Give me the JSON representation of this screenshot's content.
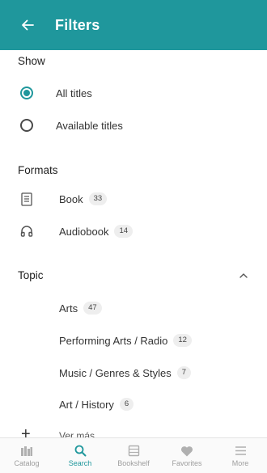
{
  "appbar": {
    "title": "Filters"
  },
  "show": {
    "label": "Show",
    "options": [
      {
        "label": "All titles",
        "selected": true
      },
      {
        "label": "Available titles",
        "selected": false
      }
    ]
  },
  "formats": {
    "label": "Formats",
    "items": [
      {
        "label": "Book",
        "count": "33",
        "icon": "book-icon"
      },
      {
        "label": "Audiobook",
        "count": "14",
        "icon": "headphones-icon"
      }
    ]
  },
  "topic": {
    "label": "Topic",
    "expanded": true,
    "items": [
      {
        "label": "Arts",
        "count": "47"
      },
      {
        "label": "Performing Arts / Radio",
        "count": "12"
      },
      {
        "label": "Music / Genres & Styles",
        "count": "7"
      },
      {
        "label": "Art / History",
        "count": "6"
      }
    ],
    "more_label": "Ver más"
  },
  "bottom_nav": {
    "items": [
      {
        "label": "Catalog",
        "icon": "catalog-icon",
        "active": false
      },
      {
        "label": "Search",
        "icon": "search-icon",
        "active": true
      },
      {
        "label": "Bookshelf",
        "icon": "bookshelf-icon",
        "active": false
      },
      {
        "label": "Favorites",
        "icon": "heart-icon",
        "active": false
      },
      {
        "label": "More",
        "icon": "menu-icon",
        "active": false
      }
    ]
  },
  "colors": {
    "accent": "#1f979c",
    "inactive": "#9e9e9e"
  }
}
